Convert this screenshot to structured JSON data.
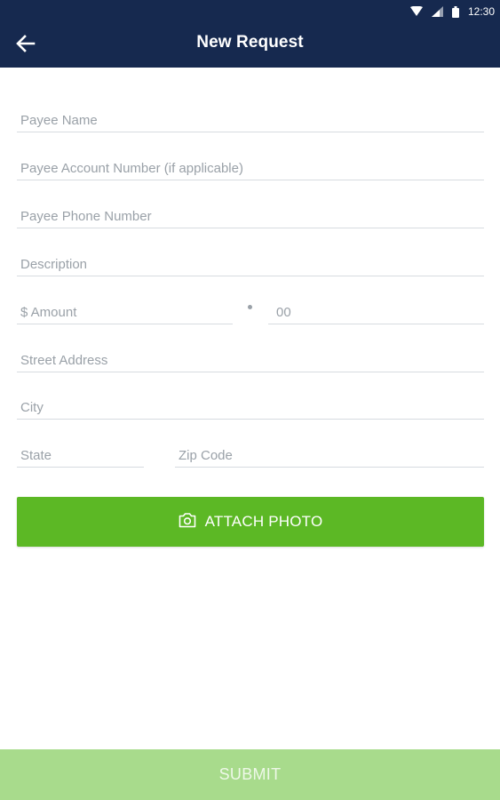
{
  "status_bar": {
    "time": "12:30",
    "icons": [
      "wifi-icon",
      "signal-icon",
      "battery-icon"
    ]
  },
  "app_bar": {
    "title": "New Request",
    "back_icon": "arrow-left-icon",
    "background": "#16294f"
  },
  "form": {
    "payee_name": {
      "placeholder": "Payee Name",
      "value": ""
    },
    "payee_account": {
      "placeholder": "Payee Account Number (if applicable)",
      "value": ""
    },
    "payee_phone": {
      "placeholder": "Payee Phone Number",
      "value": ""
    },
    "description": {
      "placeholder": "Description",
      "value": ""
    },
    "amount_dollars": {
      "placeholder": "$ Amount",
      "value": ""
    },
    "amount_cents": {
      "placeholder": "00",
      "value": ""
    },
    "street_address": {
      "placeholder": "Street Address",
      "value": ""
    },
    "city": {
      "placeholder": "City",
      "value": ""
    },
    "state": {
      "placeholder": "State",
      "value": ""
    },
    "zip_code": {
      "placeholder": "Zip Code",
      "value": ""
    }
  },
  "attach_photo": {
    "label": "ATTACH PHOTO",
    "icon": "camera-icon",
    "color": "#5cb825"
  },
  "submit": {
    "label": "SUBMIT",
    "color": "#a8db8c"
  }
}
